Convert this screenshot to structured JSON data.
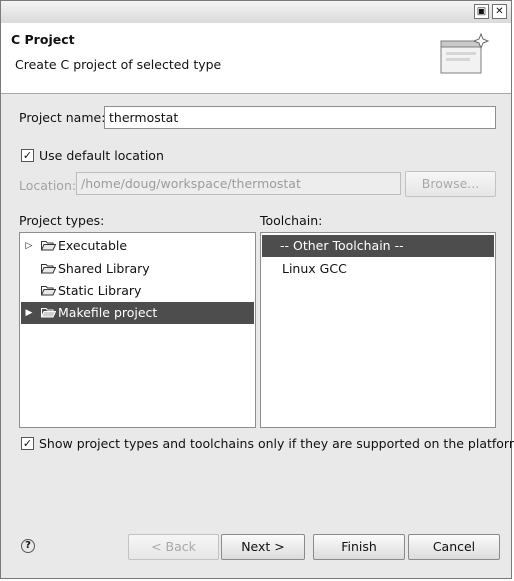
{
  "wizard": {
    "title": "C Project",
    "subtitle": "Create C project of selected type"
  },
  "form": {
    "project_name_label": "Project name:",
    "project_name_value": "thermostat",
    "use_default_location_label": "Use default location",
    "use_default_location_checked": true,
    "location_label": "Location:",
    "location_value": "/home/doug/workspace/thermostat",
    "browse_label": "Browse..."
  },
  "project_types": {
    "label": "Project types:",
    "items": [
      {
        "label": "Executable",
        "expandable": true,
        "selected": false
      },
      {
        "label": "Shared Library",
        "expandable": false,
        "selected": false
      },
      {
        "label": "Static Library",
        "expandable": false,
        "selected": false
      },
      {
        "label": "Makefile project",
        "expandable": true,
        "selected": true
      }
    ]
  },
  "toolchain": {
    "label": "Toolchain:",
    "items": [
      {
        "label": "-- Other Toolchain --",
        "selected": true
      },
      {
        "label": "Linux GCC",
        "selected": false
      }
    ]
  },
  "filter_checkbox": {
    "label": "Show project types and toolchains only if they are supported on the platform",
    "checked": true
  },
  "buttons": {
    "help": "?",
    "back": "< Back",
    "next": "Next >",
    "finish": "Finish",
    "cancel": "Cancel"
  },
  "icons": {
    "window_menu": "window-menu-icon",
    "close": "close-icon",
    "banner": "new-project-wizard-icon",
    "folder": "folder-icon",
    "expander": "triangle-right-icon",
    "help": "help-icon"
  }
}
